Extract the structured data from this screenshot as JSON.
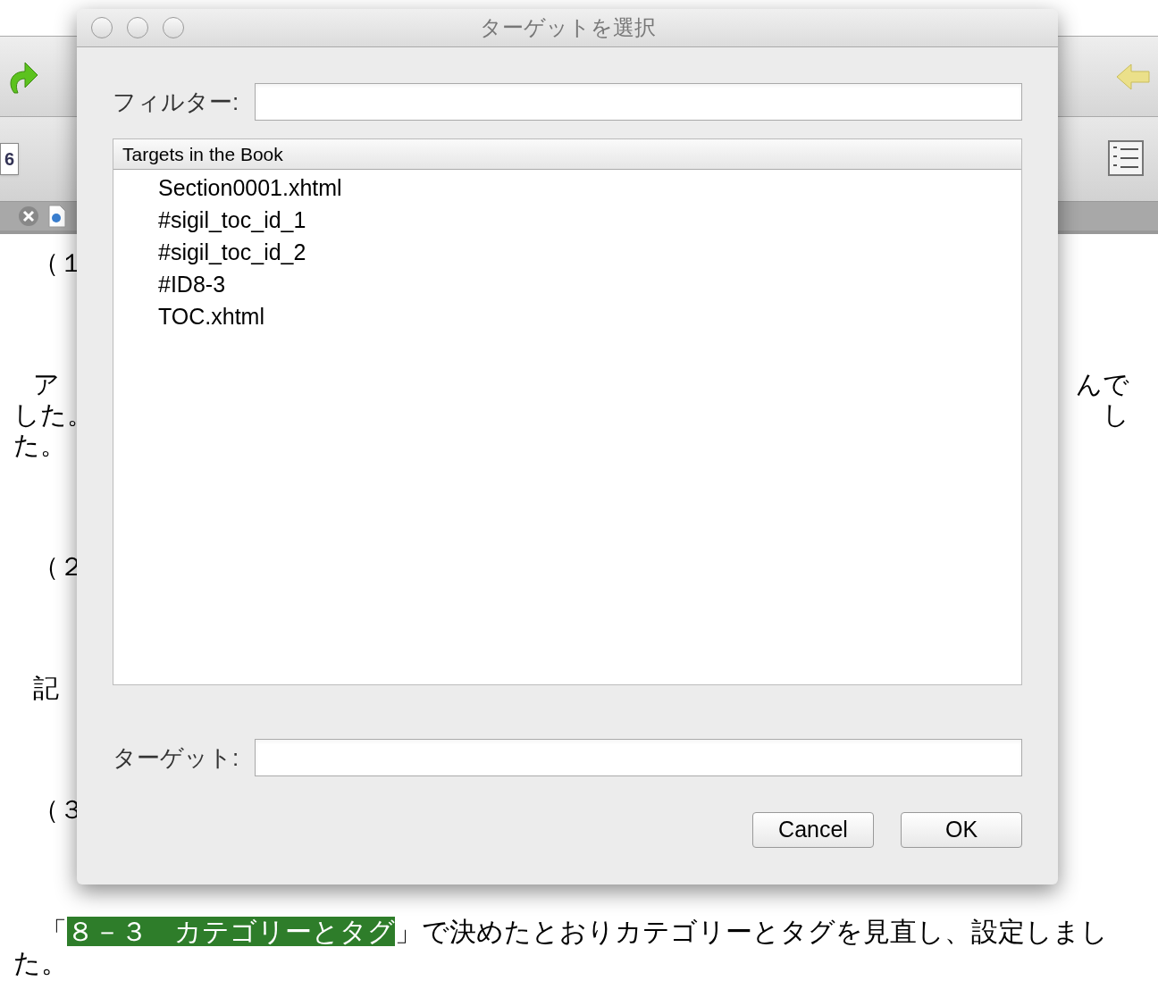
{
  "toolbar": {
    "heading_button": "6"
  },
  "document": {
    "blocks": [
      {
        "lines": [
          {
            "left": "（１",
            "indent": true
          }
        ]
      },
      {
        "lines": [
          {
            "left": "ア",
            "right": "んで",
            "indent": true
          },
          {
            "left": "した。",
            "right": "し",
            "indent": false
          },
          {
            "left": "た。",
            "indent": false
          }
        ]
      },
      {
        "lines": [
          {
            "left": "（２",
            "indent": true
          }
        ]
      },
      {
        "lines": [
          {
            "left": "記",
            "indent": true
          }
        ]
      },
      {
        "lines": [
          {
            "left": "（３",
            "indent": true
          }
        ]
      }
    ],
    "paragraph": {
      "before": "「",
      "highlight": "８－３　カテゴリーとタグ",
      "after": "」で決めたとおりカテゴリーとタグを見直し、設定しました。"
    }
  },
  "dialog": {
    "title": "ターゲットを選択",
    "filter": {
      "label": "フィルター:"
    },
    "list": {
      "header": "Targets in the Book",
      "items": [
        {
          "label": "Section0001.xhtml",
          "selected": false
        },
        {
          "label": "#sigil_toc_id_1",
          "selected": false
        },
        {
          "label": "#sigil_toc_id_2",
          "selected": false
        },
        {
          "label": "#ID8-3",
          "selected": false
        },
        {
          "label": "TOC.xhtml",
          "selected": false
        }
      ]
    },
    "target": {
      "label": "ターゲット:"
    },
    "buttons": [
      "Cancel",
      "OK"
    ]
  }
}
